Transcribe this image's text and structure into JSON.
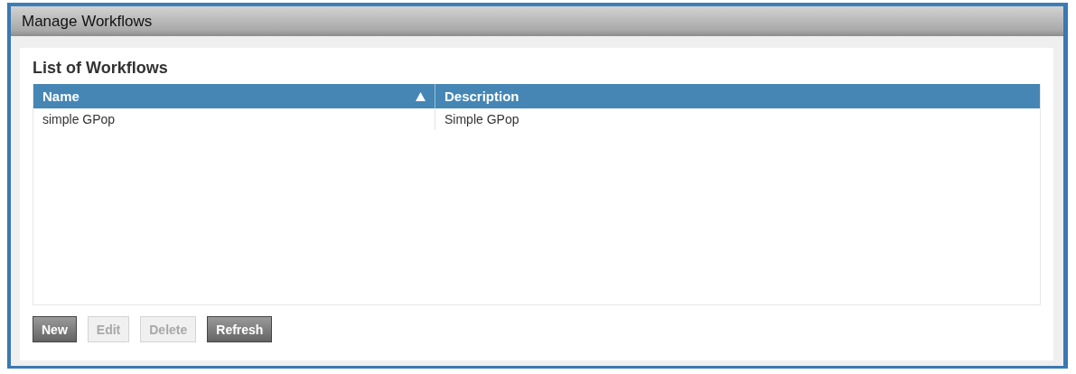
{
  "window": {
    "title": "Manage Workflows"
  },
  "panel": {
    "heading": "List of Workflows"
  },
  "table": {
    "columns": [
      {
        "label": "Name",
        "sorted": true
      },
      {
        "label": "Description",
        "sorted": false
      }
    ],
    "rows": [
      {
        "cells": [
          "simple GPop",
          "Simple GPop"
        ],
        "selected": false
      }
    ]
  },
  "buttons": [
    {
      "label": "New",
      "disabled": false
    },
    {
      "label": "Edit",
      "disabled": true
    },
    {
      "label": "Delete",
      "disabled": true
    },
    {
      "label": "Refresh",
      "disabled": false
    }
  ]
}
